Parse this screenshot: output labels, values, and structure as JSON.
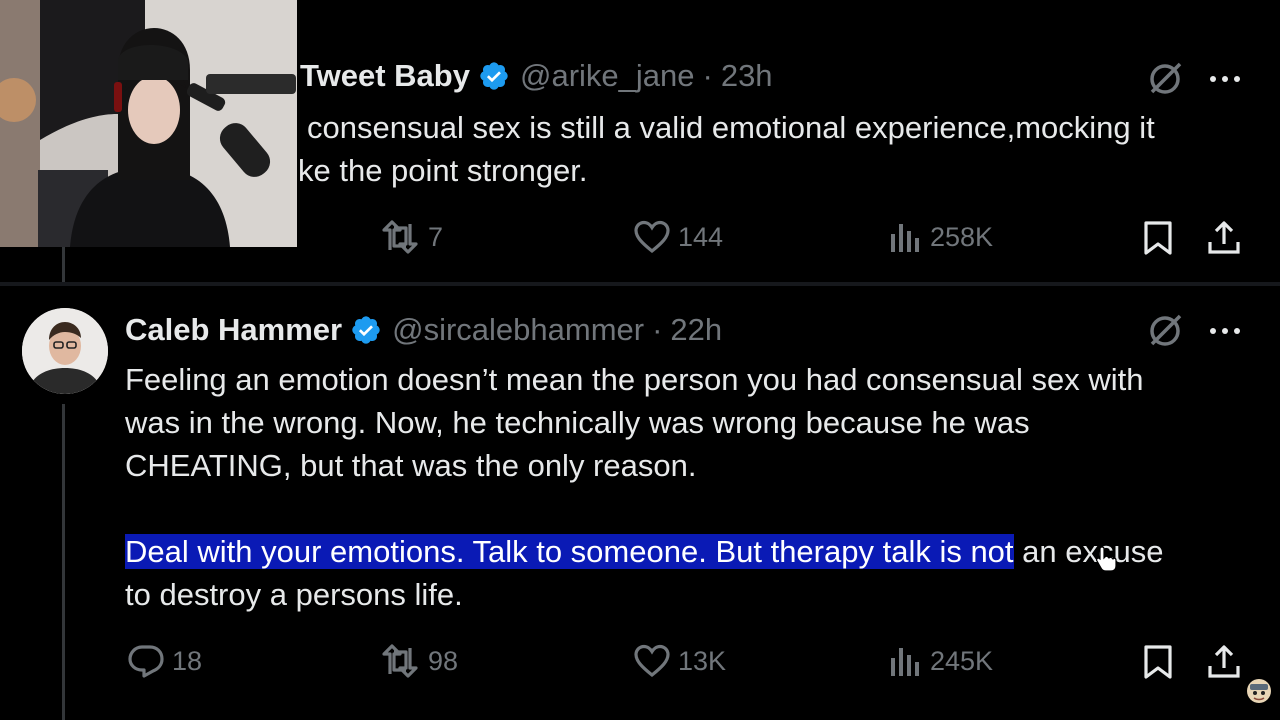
{
  "tweet_top": {
    "display_name": "Tweet Baby",
    "handle": "@arike_jane",
    "separator": "·",
    "time": "23h",
    "text_line1": "consensual sex is still a valid emotional experience,mocking it",
    "text_line2": "ke the point stronger.",
    "retweets": "7",
    "likes": "144",
    "views": "258K"
  },
  "tweet_main": {
    "display_name": "Caleb Hammer",
    "handle": "@sircalebhammer",
    "separator": "·",
    "time": "22h",
    "text_line1": "Feeling an emotion doesn’t mean the person you had consensual sex with",
    "text_line2": "was in the wrong. Now, he technically was wrong because he was",
    "text_line3": "CHEATING, but that was the only reason.",
    "text_line4_highlighted": "Deal with your emotions. Talk to someone. But therapy talk is not",
    "text_line4_rest": " an excuse",
    "text_line5": "to destroy a persons life.",
    "replies": "18",
    "retweets": "98",
    "likes": "13K",
    "views": "245K"
  },
  "colors": {
    "background": "#000000",
    "text": "#e7e9ea",
    "muted": "#71767b",
    "verified": "#1d9bf0",
    "selection": "#0a1ab5"
  },
  "icons": [
    "verified-badge-icon",
    "grok-icon",
    "more-icon",
    "reply-icon",
    "retweet-icon",
    "like-icon",
    "views-icon",
    "bookmark-icon",
    "share-icon"
  ]
}
